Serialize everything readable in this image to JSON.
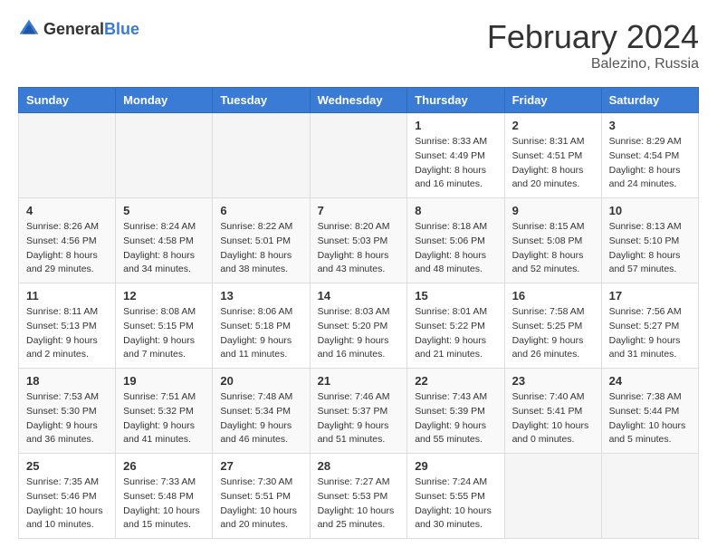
{
  "logo": {
    "text_general": "General",
    "text_blue": "Blue"
  },
  "title": "February 2024",
  "subtitle": "Balezino, Russia",
  "weekdays": [
    "Sunday",
    "Monday",
    "Tuesday",
    "Wednesday",
    "Thursday",
    "Friday",
    "Saturday"
  ],
  "weeks": [
    [
      {
        "day": "",
        "info": ""
      },
      {
        "day": "",
        "info": ""
      },
      {
        "day": "",
        "info": ""
      },
      {
        "day": "",
        "info": ""
      },
      {
        "day": "1",
        "info": "Sunrise: 8:33 AM\nSunset: 4:49 PM\nDaylight: 8 hours\nand 16 minutes."
      },
      {
        "day": "2",
        "info": "Sunrise: 8:31 AM\nSunset: 4:51 PM\nDaylight: 8 hours\nand 20 minutes."
      },
      {
        "day": "3",
        "info": "Sunrise: 8:29 AM\nSunset: 4:54 PM\nDaylight: 8 hours\nand 24 minutes."
      }
    ],
    [
      {
        "day": "4",
        "info": "Sunrise: 8:26 AM\nSunset: 4:56 PM\nDaylight: 8 hours\nand 29 minutes."
      },
      {
        "day": "5",
        "info": "Sunrise: 8:24 AM\nSunset: 4:58 PM\nDaylight: 8 hours\nand 34 minutes."
      },
      {
        "day": "6",
        "info": "Sunrise: 8:22 AM\nSunset: 5:01 PM\nDaylight: 8 hours\nand 38 minutes."
      },
      {
        "day": "7",
        "info": "Sunrise: 8:20 AM\nSunset: 5:03 PM\nDaylight: 8 hours\nand 43 minutes."
      },
      {
        "day": "8",
        "info": "Sunrise: 8:18 AM\nSunset: 5:06 PM\nDaylight: 8 hours\nand 48 minutes."
      },
      {
        "day": "9",
        "info": "Sunrise: 8:15 AM\nSunset: 5:08 PM\nDaylight: 8 hours\nand 52 minutes."
      },
      {
        "day": "10",
        "info": "Sunrise: 8:13 AM\nSunset: 5:10 PM\nDaylight: 8 hours\nand 57 minutes."
      }
    ],
    [
      {
        "day": "11",
        "info": "Sunrise: 8:11 AM\nSunset: 5:13 PM\nDaylight: 9 hours\nand 2 minutes."
      },
      {
        "day": "12",
        "info": "Sunrise: 8:08 AM\nSunset: 5:15 PM\nDaylight: 9 hours\nand 7 minutes."
      },
      {
        "day": "13",
        "info": "Sunrise: 8:06 AM\nSunset: 5:18 PM\nDaylight: 9 hours\nand 11 minutes."
      },
      {
        "day": "14",
        "info": "Sunrise: 8:03 AM\nSunset: 5:20 PM\nDaylight: 9 hours\nand 16 minutes."
      },
      {
        "day": "15",
        "info": "Sunrise: 8:01 AM\nSunset: 5:22 PM\nDaylight: 9 hours\nand 21 minutes."
      },
      {
        "day": "16",
        "info": "Sunrise: 7:58 AM\nSunset: 5:25 PM\nDaylight: 9 hours\nand 26 minutes."
      },
      {
        "day": "17",
        "info": "Sunrise: 7:56 AM\nSunset: 5:27 PM\nDaylight: 9 hours\nand 31 minutes."
      }
    ],
    [
      {
        "day": "18",
        "info": "Sunrise: 7:53 AM\nSunset: 5:30 PM\nDaylight: 9 hours\nand 36 minutes."
      },
      {
        "day": "19",
        "info": "Sunrise: 7:51 AM\nSunset: 5:32 PM\nDaylight: 9 hours\nand 41 minutes."
      },
      {
        "day": "20",
        "info": "Sunrise: 7:48 AM\nSunset: 5:34 PM\nDaylight: 9 hours\nand 46 minutes."
      },
      {
        "day": "21",
        "info": "Sunrise: 7:46 AM\nSunset: 5:37 PM\nDaylight: 9 hours\nand 51 minutes."
      },
      {
        "day": "22",
        "info": "Sunrise: 7:43 AM\nSunset: 5:39 PM\nDaylight: 9 hours\nand 55 minutes."
      },
      {
        "day": "23",
        "info": "Sunrise: 7:40 AM\nSunset: 5:41 PM\nDaylight: 10 hours\nand 0 minutes."
      },
      {
        "day": "24",
        "info": "Sunrise: 7:38 AM\nSunset: 5:44 PM\nDaylight: 10 hours\nand 5 minutes."
      }
    ],
    [
      {
        "day": "25",
        "info": "Sunrise: 7:35 AM\nSunset: 5:46 PM\nDaylight: 10 hours\nand 10 minutes."
      },
      {
        "day": "26",
        "info": "Sunrise: 7:33 AM\nSunset: 5:48 PM\nDaylight: 10 hours\nand 15 minutes."
      },
      {
        "day": "27",
        "info": "Sunrise: 7:30 AM\nSunset: 5:51 PM\nDaylight: 10 hours\nand 20 minutes."
      },
      {
        "day": "28",
        "info": "Sunrise: 7:27 AM\nSunset: 5:53 PM\nDaylight: 10 hours\nand 25 minutes."
      },
      {
        "day": "29",
        "info": "Sunrise: 7:24 AM\nSunset: 5:55 PM\nDaylight: 10 hours\nand 30 minutes."
      },
      {
        "day": "",
        "info": ""
      },
      {
        "day": "",
        "info": ""
      }
    ]
  ]
}
